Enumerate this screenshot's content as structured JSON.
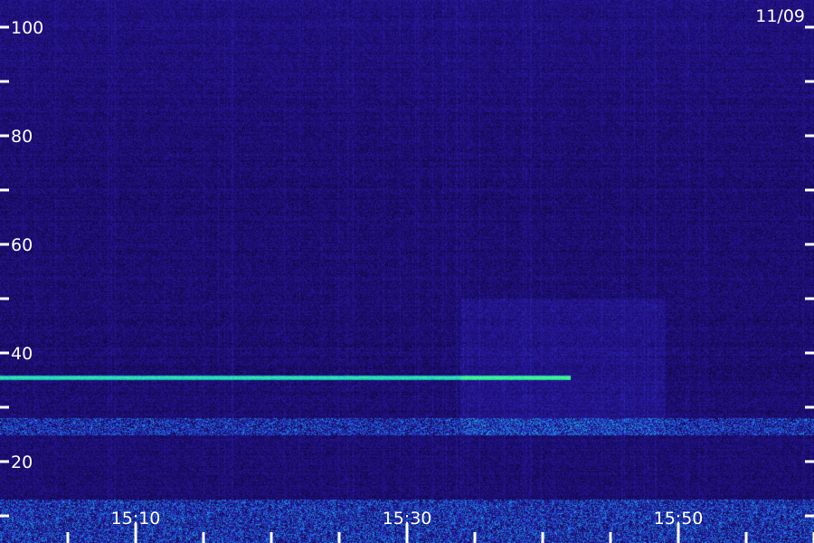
{
  "chart_data": {
    "type": "heatmap",
    "title": "",
    "xlabel": "",
    "ylabel": "",
    "date": "11/09",
    "y_tick_labels": [
      "100",
      "80",
      "60",
      "40",
      "20"
    ],
    "y_major_ticks": [
      100,
      80,
      60,
      40,
      20
    ],
    "y_minor_ticks": [
      90,
      70,
      50,
      30,
      10
    ],
    "ylim": [
      0,
      105
    ],
    "x_tick_labels": [
      "15:10",
      "15:30",
      "15:50"
    ],
    "x_major_ticks": [
      "15:10",
      "15:30",
      "15:50"
    ],
    "x_minor_ticks": [
      "15:05",
      "15:15",
      "15:20",
      "15:25",
      "15:35",
      "15:40",
      "15:45",
      "15:55",
      "16:00"
    ],
    "xlim": [
      "15:00",
      "16:00"
    ],
    "colormap": [
      "#0a0220",
      "#1a0d70",
      "#2a1aa0",
      "#2040d0",
      "#1a90e0",
      "#20e0b0",
      "#60ff60"
    ],
    "features": [
      {
        "type": "horizontal_line",
        "y": 35.5,
        "x_range": [
          "15:00",
          "15:42"
        ],
        "intensity": 0.9
      },
      {
        "type": "band",
        "y_range": [
          25,
          28
        ],
        "x_range": [
          "15:00",
          "16:00"
        ],
        "intensity": 0.75
      },
      {
        "type": "band",
        "y_range": [
          5,
          13
        ],
        "x_range": [
          "15:00",
          "16:00"
        ],
        "intensity": 0.8
      },
      {
        "type": "patch",
        "y_range": [
          25,
          50
        ],
        "x_range": [
          "15:34",
          "15:49"
        ],
        "intensity": 0.35
      }
    ]
  }
}
